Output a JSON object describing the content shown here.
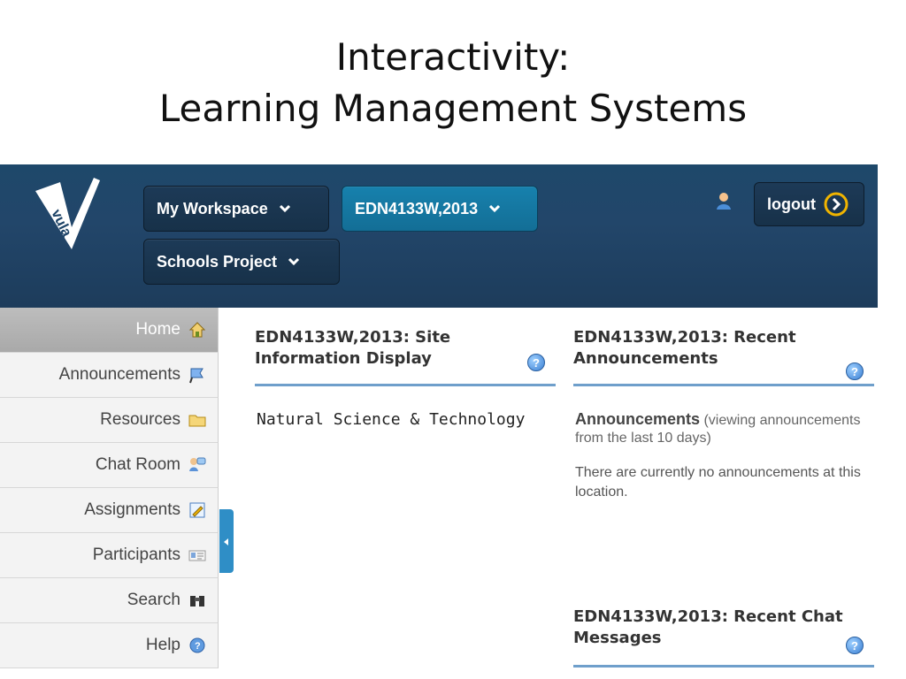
{
  "slide": {
    "title_line1": "Interactivity:",
    "title_line2": "Learning Management Systems"
  },
  "header": {
    "logo_alt": "vula",
    "workspace_label": "My Workspace",
    "site_label": "EDN4133W,2013",
    "schools_label": "Schools Project",
    "logout_label": "logout"
  },
  "sidebar": {
    "items": [
      {
        "label": "Home",
        "icon": "home-icon"
      },
      {
        "label": "Announcements",
        "icon": "flag-icon"
      },
      {
        "label": "Resources",
        "icon": "folder-icon"
      },
      {
        "label": "Chat Room",
        "icon": "chat-icon"
      },
      {
        "label": "Assignments",
        "icon": "pencil-icon"
      },
      {
        "label": "Participants",
        "icon": "id-card-icon"
      },
      {
        "label": "Search",
        "icon": "binoculars-icon"
      },
      {
        "label": "Help",
        "icon": "help-icon"
      }
    ]
  },
  "panels": {
    "site_info": {
      "title": "EDN4133W,2013: Site Information Display",
      "content": "Natural Science & Technology"
    },
    "announcements": {
      "title": "EDN4133W,2013: Recent Announcements",
      "heading_bold": "Announcements",
      "heading_note": "(viewing announcements from the last 10 days)",
      "empty_text": "There are currently no announcements at this location."
    },
    "chat": {
      "title": "EDN4133W,2013: Recent Chat Messages"
    }
  },
  "colors": {
    "header_bg": "#22466a",
    "active_pill": "#1781ad",
    "accent_tab": "#2f8ec6",
    "panel_rule": "#6f9fcb"
  }
}
